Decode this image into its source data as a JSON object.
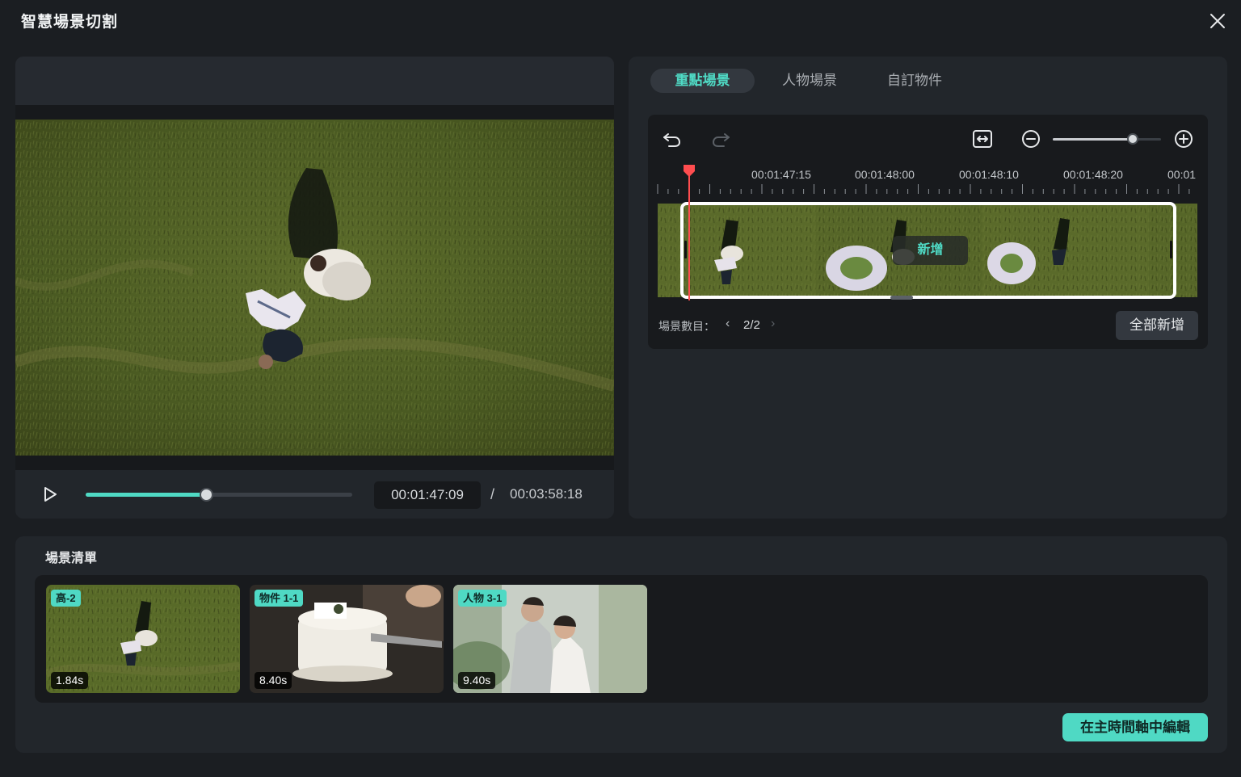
{
  "window": {
    "title": "智慧場景切割"
  },
  "preview": {
    "current_time": "00:01:47:09",
    "separator": "/",
    "total_time": "00:03:58:18",
    "progress": 0.45
  },
  "tabs": [
    {
      "label": "重點場景",
      "active": true
    },
    {
      "label": "人物場景",
      "active": false
    },
    {
      "label": "自訂物件",
      "active": false
    }
  ],
  "timeline": {
    "ruler_labels": [
      "00:01:47:15",
      "00:01:48:00",
      "00:01:48:10",
      "00:01:48:20",
      "00:01"
    ],
    "zoom_level": 0.74,
    "add_chip": "新增",
    "scene_count_label": "場景數目：",
    "scene_count_value": "2/2",
    "add_all_button": "全部新增"
  },
  "scene_list": {
    "label": "場景清單",
    "items": [
      {
        "tag": "高-2",
        "duration": "1.84s"
      },
      {
        "tag": "物件 1-1",
        "duration": "8.40s"
      },
      {
        "tag": "人物 3-1",
        "duration": "9.40s"
      }
    ]
  },
  "footer": {
    "edit_in_timeline": "在主時間軸中編輯"
  },
  "colors": {
    "accent": "#4fd9c4",
    "playhead": "#ff4d4f",
    "panel": "#22262b",
    "background": "#1b1e22"
  }
}
